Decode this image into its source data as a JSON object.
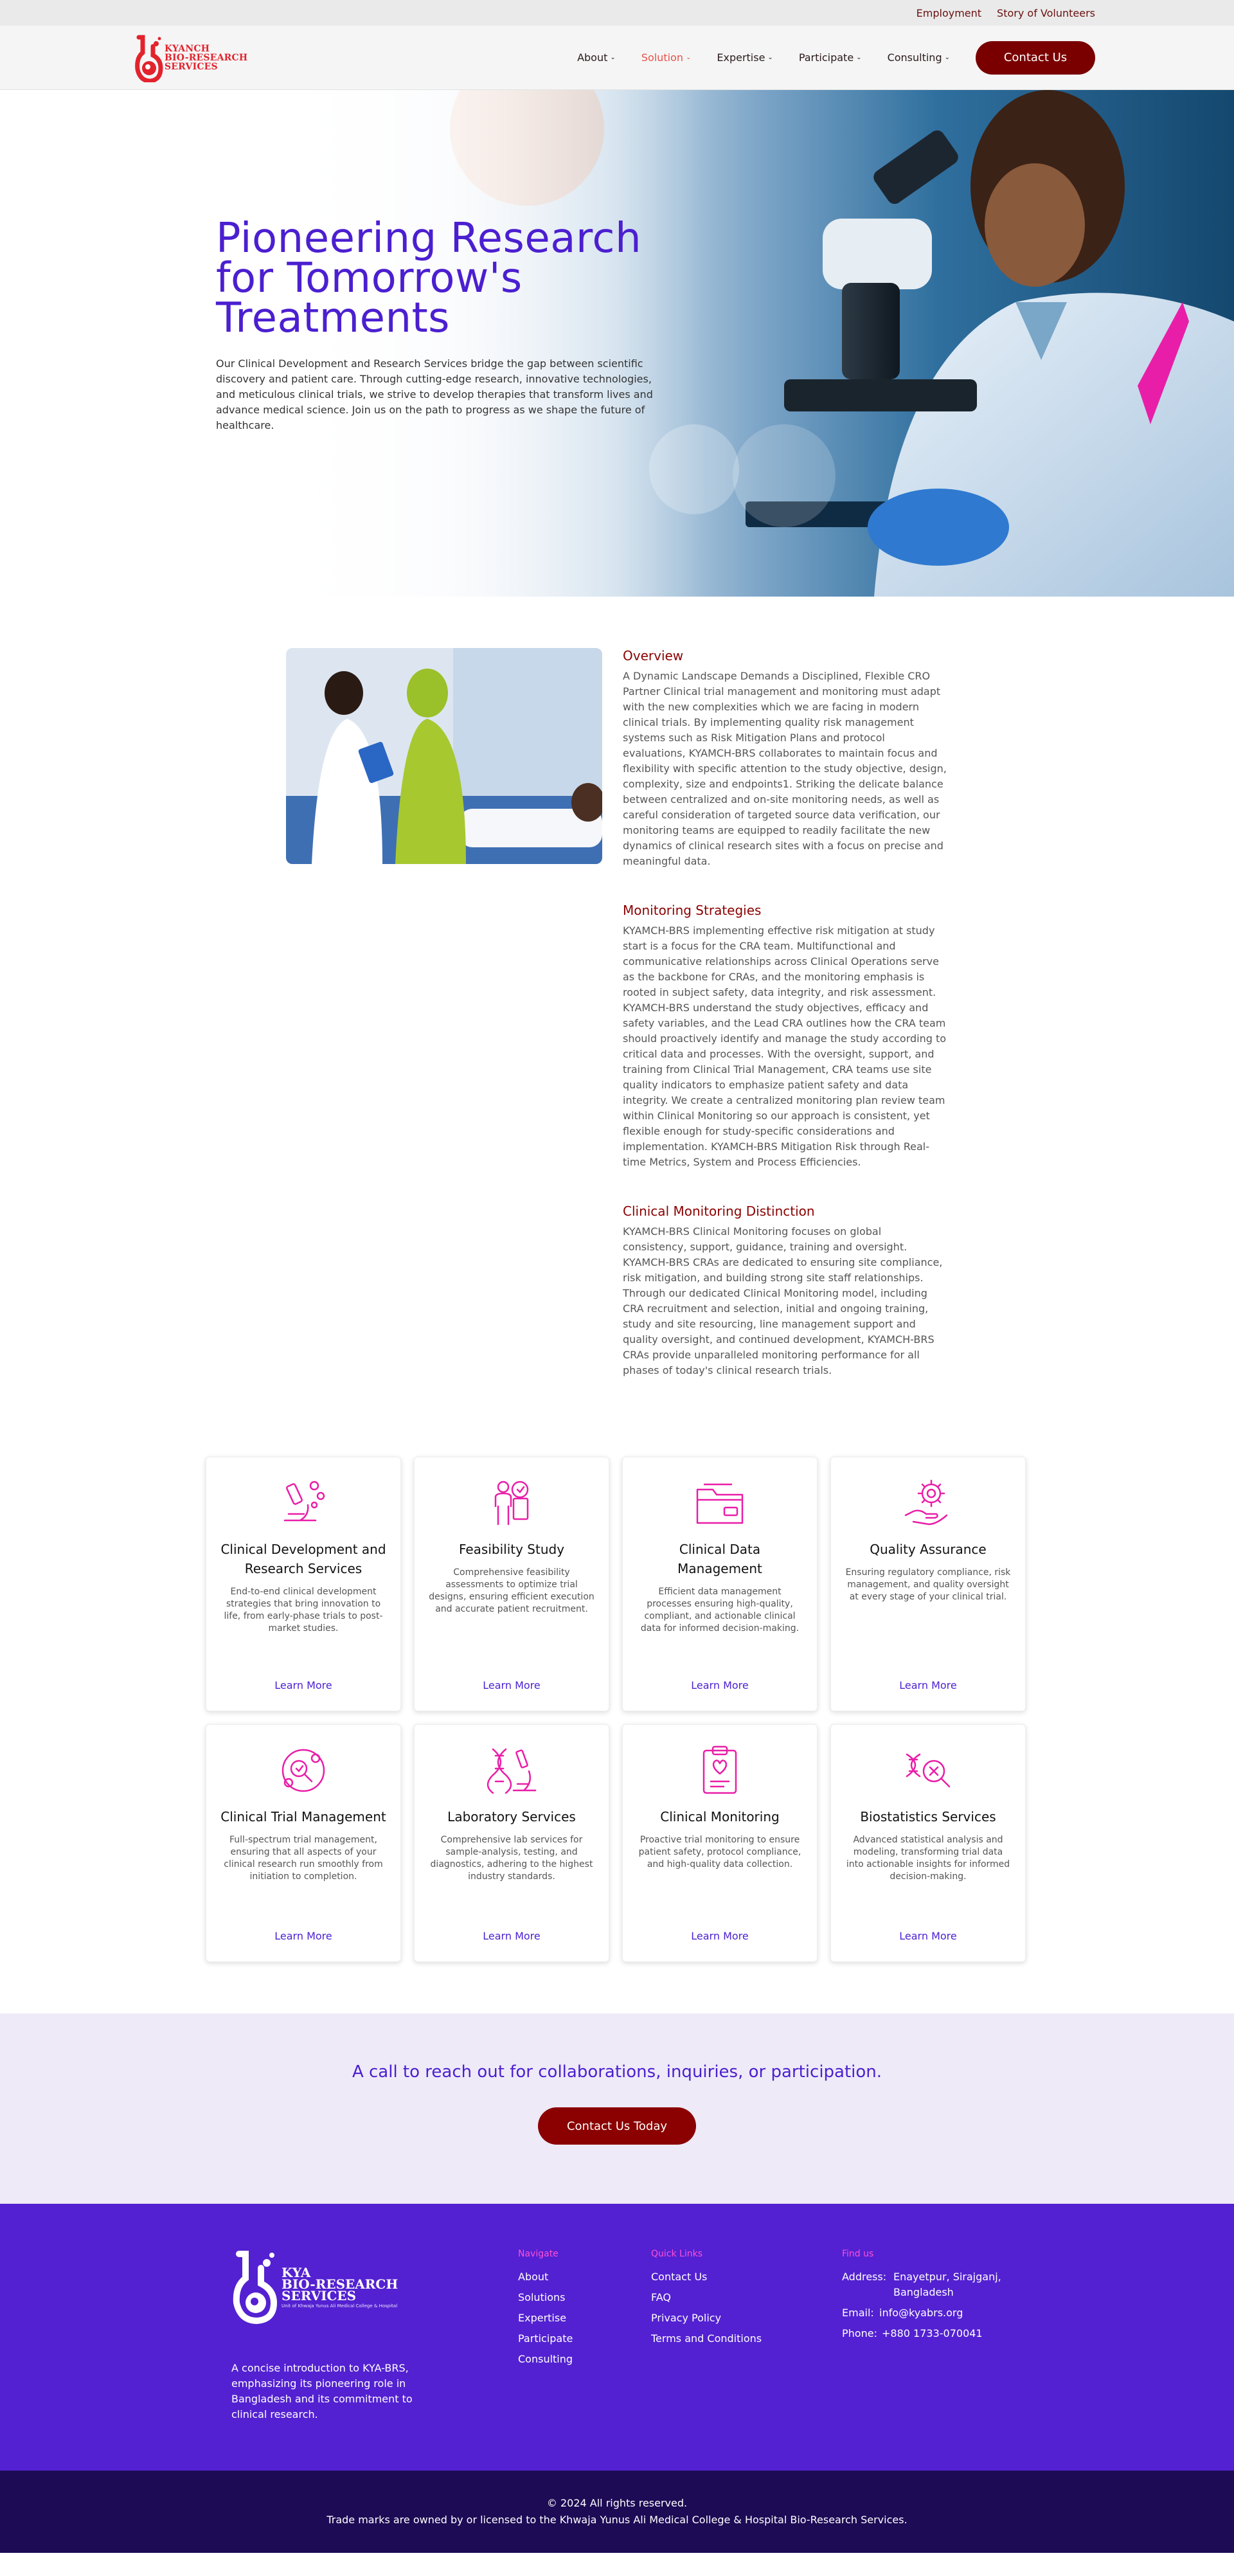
{
  "topbar": {
    "links": [
      "Employment",
      "Story of Volunteers"
    ]
  },
  "brand": {
    "line1": "KYANCH",
    "line2": "BIO-RESEARCH",
    "line3": "SERVICES"
  },
  "nav": {
    "items": [
      "About",
      "Solution",
      "Expertise",
      "Participate",
      "Consulting"
    ],
    "active_index": 1,
    "contact_label": "Contact Us"
  },
  "hero": {
    "title": "Pioneering Research for Tomorrow's Treatments",
    "text": "Our Clinical Development and Research Services bridge the gap between scientific discovery and patient care. Through cutting-edge research, innovative technologies, and meticulous clinical trials, we strive to develop therapies that transform lives and advance medical science. Join us on the path to progress as we shape the future of healthcare."
  },
  "overview": {
    "blocks": [
      {
        "title": "Overview",
        "text": "A Dynamic Landscape Demands a Disciplined, Flexible CRO Partner Clinical trial management and monitoring must adapt with the new complexities which we are facing in modern clinical trials. By implementing quality risk management systems such as Risk Mitigation Plans and protocol evaluations, KYAMCH-BRS collaborates to maintain focus and flexibility with specific attention to the study objective, design, complexity, size and endpoints1. Striking the delicate balance between centralized and on-site monitoring needs, as well as careful consideration of targeted source data verification, our monitoring teams are equipped to readily facilitate the new dynamics of clinical research sites with a focus on precise and meaningful data."
      },
      {
        "title": "Monitoring Strategies",
        "text": "KYAMCH-BRS implementing effective risk mitigation at study start is a focus for the CRA team. Multifunctional and communicative relationships across Clinical Operations serve as the backbone for CRAs, and the monitoring emphasis is rooted in subject safety, data integrity, and risk assessment. KYAMCH-BRS understand the study objectives, efficacy and safety variables, and the Lead CRA outlines how the CRA team should proactively identify and manage the study according to critical data and processes. With the oversight, support, and training from Clinical Trial Management, CRA teams use site quality indicators to emphasize patient safety and data integrity. We create a centralized monitoring plan review team within Clinical Monitoring so our approach is consistent, yet flexible enough for study-specific considerations and implementation. KYAMCH-BRS Mitigation Risk through Real-time Metrics, System and Process Efficiencies."
      },
      {
        "title": "Clinical Monitoring Distinction",
        "text": "KYAMCH-BRS Clinical Monitoring focuses on global consistency, support, guidance, training and oversight. KYAMCH-BRS CRAs are dedicated to ensuring site compliance, risk mitigation, and building strong site staff relationships. Through our dedicated Clinical Monitoring model, including CRA recruitment and selection, initial and ongoing training, study and site resourcing, line management support and quality oversight, and continued development, KYAMCH-BRS CRAs provide unparalleled monitoring performance for all phases of today's clinical research trials."
      }
    ]
  },
  "services": [
    {
      "icon": "microscope-icon",
      "title": "Clinical Development and Research Services",
      "text": "End-to-end clinical development strategies that bring innovation to life, from early-phase trials to post-market studies.",
      "link": "Learn More"
    },
    {
      "icon": "feasibility-person-icon",
      "title": "Feasibility Study",
      "text": "Comprehensive feasibility assessments to optimize trial designs, ensuring efficient execution and accurate patient recruitment.",
      "link": "Learn More"
    },
    {
      "icon": "data-folder-icon",
      "title": "Clinical Data Management",
      "text": "Efficient data management processes ensuring high-quality, compliant, and actionable clinical data for informed decision-making.",
      "link": "Learn More"
    },
    {
      "icon": "quality-gear-hand-icon",
      "title": "Quality Assurance",
      "text": "Ensuring regulatory compliance, risk management, and quality oversight at every stage of your clinical trial.",
      "link": "Learn More"
    },
    {
      "icon": "trial-management-icon",
      "title": "Clinical Trial Management",
      "text": "Full-spectrum trial management, ensuring that all aspects of your clinical research run smoothly from initiation to completion.",
      "link": "Learn More"
    },
    {
      "icon": "dna-microscope-icon",
      "title": "Laboratory Services",
      "text": "Comprehensive lab services for sample-analysis, testing, and diagnostics, adhering to the highest industry standards.",
      "link": "Learn More"
    },
    {
      "icon": "clipboard-heart-icon",
      "title": "Clinical Monitoring",
      "text": "Proactive trial monitoring to ensure patient safety, protocol compliance, and high-quality data collection.",
      "link": "Learn More"
    },
    {
      "icon": "dna-magnifier-icon",
      "title": "Biostatistics Services",
      "text": "Advanced statistical analysis and modeling, transforming trial data into actionable insights for informed decision-making.",
      "link": "Learn More"
    }
  ],
  "cta": {
    "title": "A call to reach out for collaborations, inquiries, or participation.",
    "button": "Contact Us Today"
  },
  "footer": {
    "logo": {
      "line1": "KYA",
      "line2": "BIO-RESEARCH",
      "line3": "SERVICES",
      "tagline": "Unit of Khwaja Yunus Ali Medical College & Hospital"
    },
    "about": "A concise introduction to KYA-BRS, emphasizing its pioneering role in Bangladesh and its commitment to clinical research.",
    "navigate": {
      "title": "Navigate",
      "links": [
        "About",
        "Solutions",
        "Expertise",
        "Participate",
        "Consulting"
      ]
    },
    "quick": {
      "title": "Quick Links",
      "links": [
        "Contact Us",
        "FAQ",
        "Privacy Policy",
        "Terms and Conditions"
      ]
    },
    "find": {
      "title": "Find us",
      "address_label": "Address:",
      "address": "Enayetpur, Sirajganj, Bangladesh",
      "email_label": "Email:",
      "email": "info@kyabrs.org",
      "phone_label": "Phone:",
      "phone": "+880 1733-070041"
    },
    "copyright": "© 2024  All rights reserved.",
    "trademark": "Trade marks are owned by or licensed to the Khwaja Yunus Ali Medical College & Hospital Bio-Research Services."
  },
  "colors": {
    "primary_purple": "#4b1fd0",
    "brand_red": "#e2232d",
    "dark_red": "#7a0000",
    "accent_pink": "#e91ea8",
    "footer_bg": "#5321d1",
    "footer_bottom": "#1d0b55"
  }
}
